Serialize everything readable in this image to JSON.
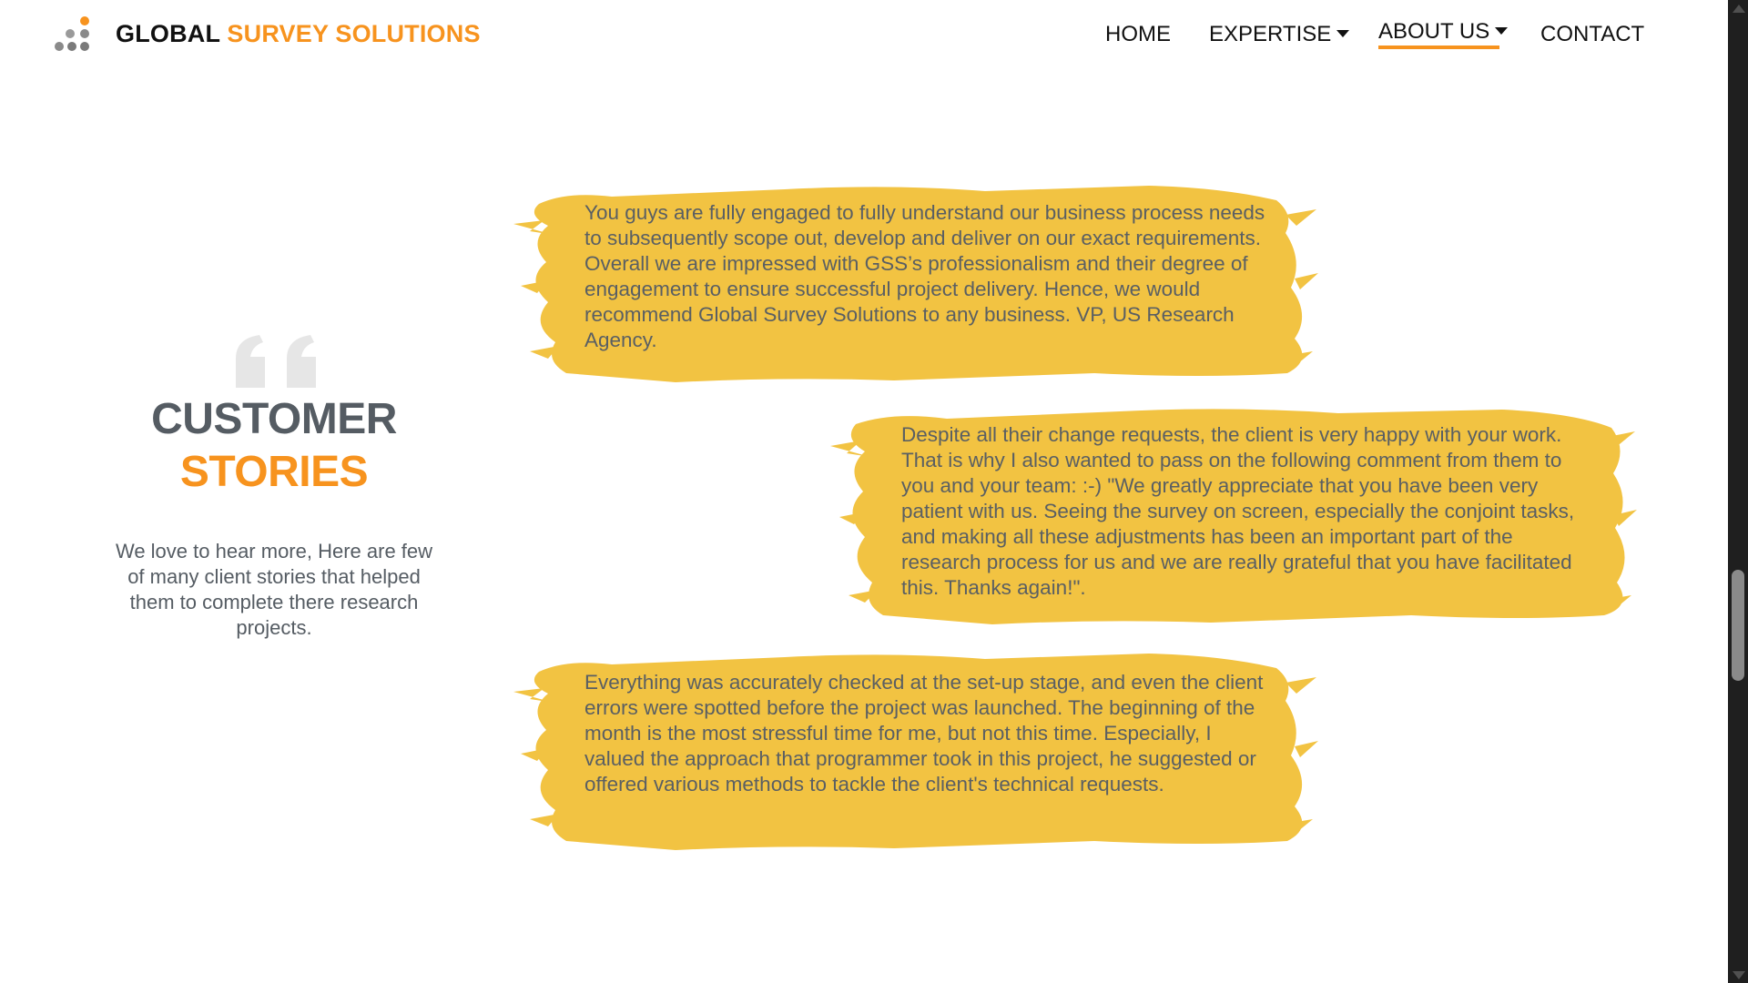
{
  "header": {
    "brand_part1": "GLOBAL",
    "brand_part2": "SURVEY SOLUTIONS",
    "brand_colors": {
      "dark": "#111111",
      "accent": "#f7931e"
    },
    "logo_icon": "dots-logo-icon"
  },
  "nav": {
    "items": [
      {
        "label": "HOME",
        "has_dropdown": false,
        "active": false
      },
      {
        "label": "EXPERTISE",
        "has_dropdown": true,
        "active": false
      },
      {
        "label": "ABOUT US",
        "has_dropdown": true,
        "active": true
      },
      {
        "label": "CONTACT",
        "has_dropdown": false,
        "active": false
      }
    ],
    "dropdown_icon": "caret-down-icon"
  },
  "stories": {
    "quote_icon": "quote-icon",
    "title_line1": "CUSTOMER",
    "title_line2": "STORIES",
    "description": "We love to hear more, Here are few of many client stories that helped them to complete there research projects."
  },
  "testimonials": [
    {
      "text": "You guys are fully engaged to fully understand our business process needs to subsequently scope out, develop and deliver on our exact requirements. Overall we are impressed with GSS’s professionalism and their degree of engagement to ensure successful project delivery. Hence, we would recommend Global Survey Solutions to any business. VP, US Research Agency."
    },
    {
      "text": "Despite all their change requests, the client is very happy with your work. That is why I also wanted to pass on the following comment from them to you and your team: :-) \"We greatly appreciate that you have been very patient with us. Seeing the survey on screen, especially the conjoint tasks, and making all these adjustments has been an important part of the research process for us and we are really grateful that you have facilitated this. Thanks again!\"."
    },
    {
      "text": "Everything was accurately checked at the set-up stage, and even the client errors were spotted before the project was launched. The beginning of the month is the most stressful time for me, but not this time. Especially, I valued the approach that programmer took in this project, he suggested or offered various methods to tackle the client's technical requests."
    }
  ],
  "colors": {
    "accent": "#f7931e",
    "brush": "#f2c342",
    "heading_gray": "#555c63",
    "text_gray": "#5a5f63"
  }
}
